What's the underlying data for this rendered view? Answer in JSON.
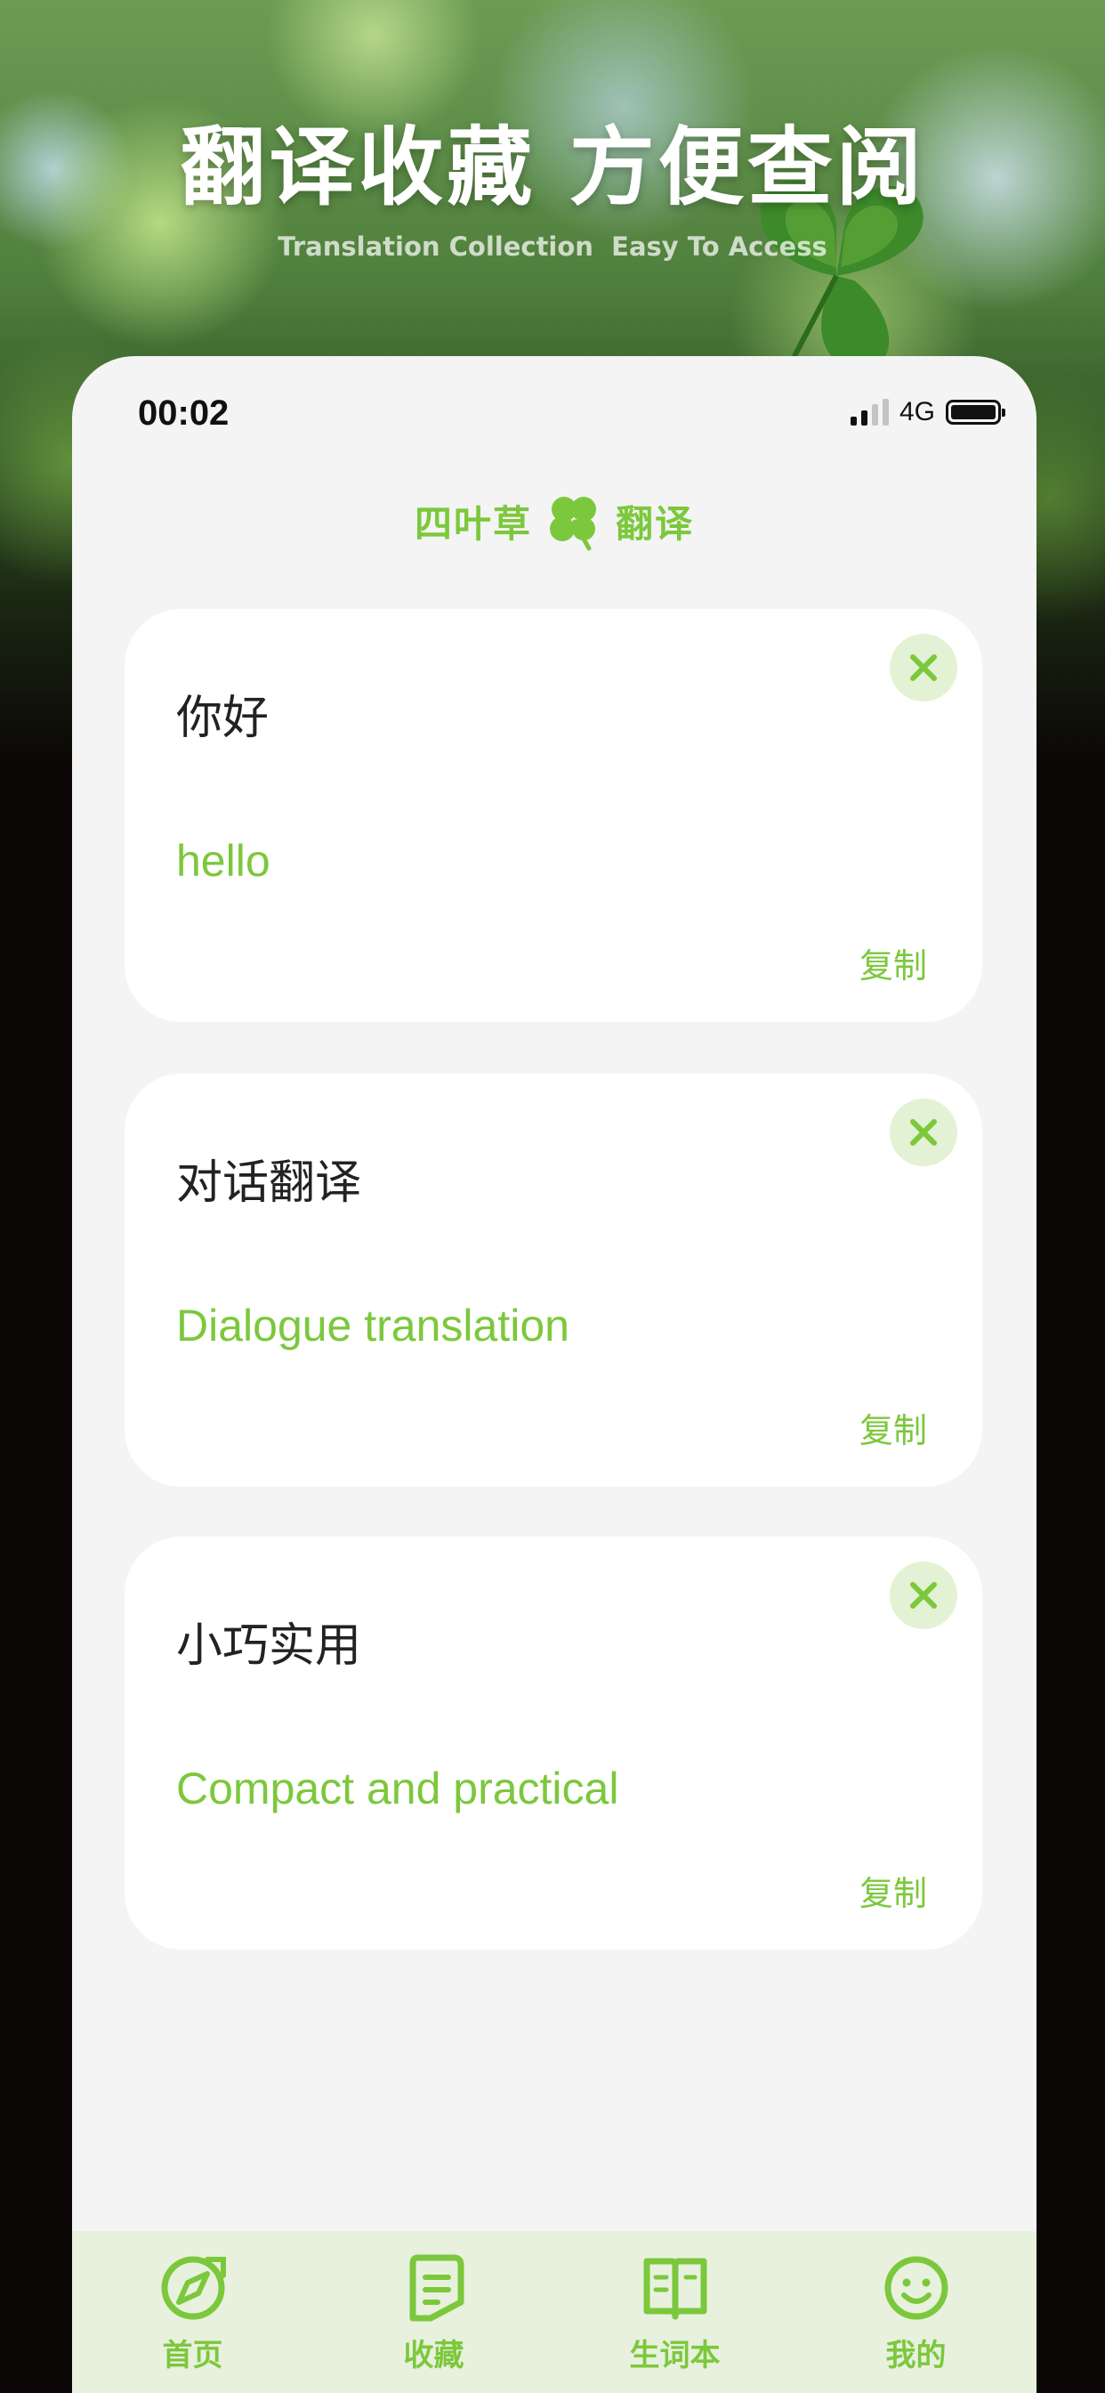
{
  "promo": {
    "headline": "翻译收藏 方便查阅",
    "subheadline": "Translation Collection  Easy To Access"
  },
  "status_bar": {
    "time": "00:02",
    "network": "4G",
    "signal_bars": 2,
    "battery_level": 1.0
  },
  "brand": {
    "left_text": "四叶草",
    "right_text": "翻译",
    "icon": "four-leaf-clover-icon"
  },
  "favorites": [
    {
      "source": "你好",
      "translation": "hello",
      "copy_label": "复制"
    },
    {
      "source": "对话翻译",
      "translation": "Dialogue translation",
      "copy_label": "复制"
    },
    {
      "source": "小巧实用",
      "translation": "Compact and practical",
      "copy_label": "复制"
    }
  ],
  "tabbar": {
    "items": [
      {
        "label": "首页",
        "icon": "compass-icon"
      },
      {
        "label": "收藏",
        "icon": "document-icon"
      },
      {
        "label": "生词本",
        "icon": "book-icon"
      },
      {
        "label": "我的",
        "icon": "smiley-icon"
      }
    ],
    "accent_color": "#7cc83c"
  },
  "colors": {
    "accent": "#7cc83c",
    "close_bg": "#e3f2d4",
    "tabbar_bg": "#e8f1de",
    "screen_bg": "#f4f4f4"
  }
}
